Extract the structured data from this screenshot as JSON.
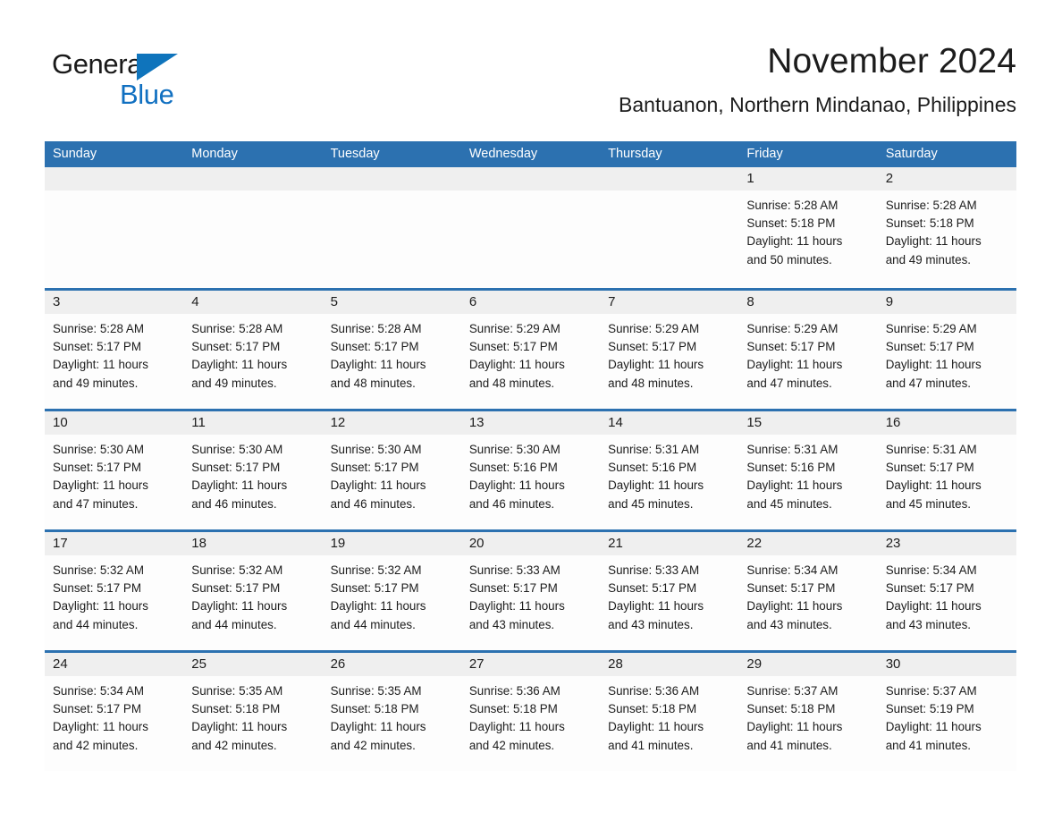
{
  "brand": {
    "word_general": "General",
    "word_blue": "Blue",
    "flag_icon": "triangle-flag-icon",
    "accent_color": "#1170c1"
  },
  "header": {
    "title": "November 2024",
    "subtitle": "Bantuanon, Northern Mindanao, Philippines"
  },
  "theme": {
    "header_blue": "#2c71b0",
    "row_divider_blue": "#2c71b0",
    "daynum_band": "#efefef",
    "cell_background": "#fdfdfd",
    "text_color": "#1c1c1c"
  },
  "calendar": {
    "month": "November",
    "year": 2024,
    "weekday_headers": [
      "Sunday",
      "Monday",
      "Tuesday",
      "Wednesday",
      "Thursday",
      "Friday",
      "Saturday"
    ],
    "weeks": [
      [
        {
          "day": "",
          "lines": []
        },
        {
          "day": "",
          "lines": []
        },
        {
          "day": "",
          "lines": []
        },
        {
          "day": "",
          "lines": []
        },
        {
          "day": "",
          "lines": []
        },
        {
          "day": "1",
          "lines": [
            "Sunrise: 5:28 AM",
            "Sunset: 5:18 PM",
            "Daylight: 11 hours",
            "and 50 minutes."
          ]
        },
        {
          "day": "2",
          "lines": [
            "Sunrise: 5:28 AM",
            "Sunset: 5:18 PM",
            "Daylight: 11 hours",
            "and 49 minutes."
          ]
        }
      ],
      [
        {
          "day": "3",
          "lines": [
            "Sunrise: 5:28 AM",
            "Sunset: 5:17 PM",
            "Daylight: 11 hours",
            "and 49 minutes."
          ]
        },
        {
          "day": "4",
          "lines": [
            "Sunrise: 5:28 AM",
            "Sunset: 5:17 PM",
            "Daylight: 11 hours",
            "and 49 minutes."
          ]
        },
        {
          "day": "5",
          "lines": [
            "Sunrise: 5:28 AM",
            "Sunset: 5:17 PM",
            "Daylight: 11 hours",
            "and 48 minutes."
          ]
        },
        {
          "day": "6",
          "lines": [
            "Sunrise: 5:29 AM",
            "Sunset: 5:17 PM",
            "Daylight: 11 hours",
            "and 48 minutes."
          ]
        },
        {
          "day": "7",
          "lines": [
            "Sunrise: 5:29 AM",
            "Sunset: 5:17 PM",
            "Daylight: 11 hours",
            "and 48 minutes."
          ]
        },
        {
          "day": "8",
          "lines": [
            "Sunrise: 5:29 AM",
            "Sunset: 5:17 PM",
            "Daylight: 11 hours",
            "and 47 minutes."
          ]
        },
        {
          "day": "9",
          "lines": [
            "Sunrise: 5:29 AM",
            "Sunset: 5:17 PM",
            "Daylight: 11 hours",
            "and 47 minutes."
          ]
        }
      ],
      [
        {
          "day": "10",
          "lines": [
            "Sunrise: 5:30 AM",
            "Sunset: 5:17 PM",
            "Daylight: 11 hours",
            "and 47 minutes."
          ]
        },
        {
          "day": "11",
          "lines": [
            "Sunrise: 5:30 AM",
            "Sunset: 5:17 PM",
            "Daylight: 11 hours",
            "and 46 minutes."
          ]
        },
        {
          "day": "12",
          "lines": [
            "Sunrise: 5:30 AM",
            "Sunset: 5:17 PM",
            "Daylight: 11 hours",
            "and 46 minutes."
          ]
        },
        {
          "day": "13",
          "lines": [
            "Sunrise: 5:30 AM",
            "Sunset: 5:16 PM",
            "Daylight: 11 hours",
            "and 46 minutes."
          ]
        },
        {
          "day": "14",
          "lines": [
            "Sunrise: 5:31 AM",
            "Sunset: 5:16 PM",
            "Daylight: 11 hours",
            "and 45 minutes."
          ]
        },
        {
          "day": "15",
          "lines": [
            "Sunrise: 5:31 AM",
            "Sunset: 5:16 PM",
            "Daylight: 11 hours",
            "and 45 minutes."
          ]
        },
        {
          "day": "16",
          "lines": [
            "Sunrise: 5:31 AM",
            "Sunset: 5:17 PM",
            "Daylight: 11 hours",
            "and 45 minutes."
          ]
        }
      ],
      [
        {
          "day": "17",
          "lines": [
            "Sunrise: 5:32 AM",
            "Sunset: 5:17 PM",
            "Daylight: 11 hours",
            "and 44 minutes."
          ]
        },
        {
          "day": "18",
          "lines": [
            "Sunrise: 5:32 AM",
            "Sunset: 5:17 PM",
            "Daylight: 11 hours",
            "and 44 minutes."
          ]
        },
        {
          "day": "19",
          "lines": [
            "Sunrise: 5:32 AM",
            "Sunset: 5:17 PM",
            "Daylight: 11 hours",
            "and 44 minutes."
          ]
        },
        {
          "day": "20",
          "lines": [
            "Sunrise: 5:33 AM",
            "Sunset: 5:17 PM",
            "Daylight: 11 hours",
            "and 43 minutes."
          ]
        },
        {
          "day": "21",
          "lines": [
            "Sunrise: 5:33 AM",
            "Sunset: 5:17 PM",
            "Daylight: 11 hours",
            "and 43 minutes."
          ]
        },
        {
          "day": "22",
          "lines": [
            "Sunrise: 5:34 AM",
            "Sunset: 5:17 PM",
            "Daylight: 11 hours",
            "and 43 minutes."
          ]
        },
        {
          "day": "23",
          "lines": [
            "Sunrise: 5:34 AM",
            "Sunset: 5:17 PM",
            "Daylight: 11 hours",
            "and 43 minutes."
          ]
        }
      ],
      [
        {
          "day": "24",
          "lines": [
            "Sunrise: 5:34 AM",
            "Sunset: 5:17 PM",
            "Daylight: 11 hours",
            "and 42 minutes."
          ]
        },
        {
          "day": "25",
          "lines": [
            "Sunrise: 5:35 AM",
            "Sunset: 5:18 PM",
            "Daylight: 11 hours",
            "and 42 minutes."
          ]
        },
        {
          "day": "26",
          "lines": [
            "Sunrise: 5:35 AM",
            "Sunset: 5:18 PM",
            "Daylight: 11 hours",
            "and 42 minutes."
          ]
        },
        {
          "day": "27",
          "lines": [
            "Sunrise: 5:36 AM",
            "Sunset: 5:18 PM",
            "Daylight: 11 hours",
            "and 42 minutes."
          ]
        },
        {
          "day": "28",
          "lines": [
            "Sunrise: 5:36 AM",
            "Sunset: 5:18 PM",
            "Daylight: 11 hours",
            "and 41 minutes."
          ]
        },
        {
          "day": "29",
          "lines": [
            "Sunrise: 5:37 AM",
            "Sunset: 5:18 PM",
            "Daylight: 11 hours",
            "and 41 minutes."
          ]
        },
        {
          "day": "30",
          "lines": [
            "Sunrise: 5:37 AM",
            "Sunset: 5:19 PM",
            "Daylight: 11 hours",
            "and 41 minutes."
          ]
        }
      ]
    ]
  }
}
